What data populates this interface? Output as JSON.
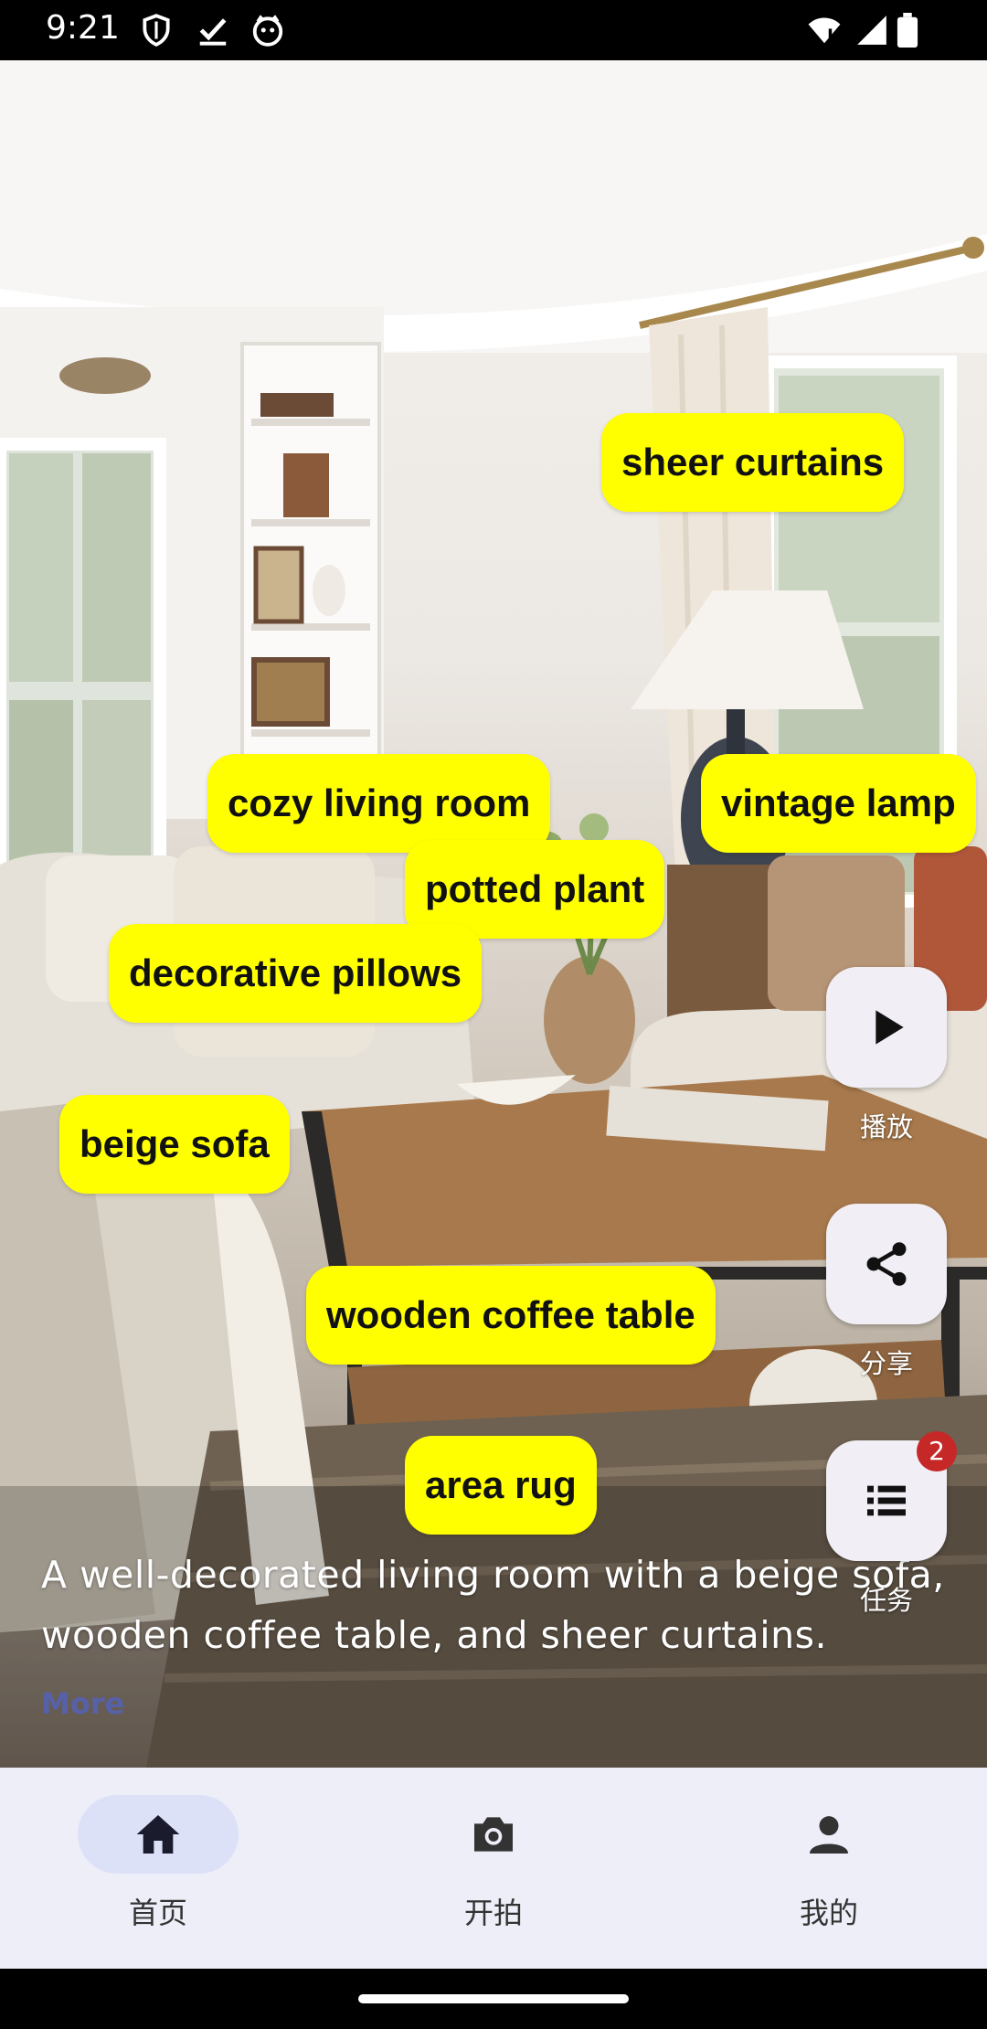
{
  "status_bar": {
    "time": "9:21",
    "icons": [
      "shield-icon",
      "check-download-icon",
      "cat-app-icon",
      "wifi-icon",
      "signal-icon",
      "battery-icon"
    ]
  },
  "scene": {
    "tags": [
      {
        "id": "sheer-curtains",
        "label": "sheer curtains"
      },
      {
        "id": "cozy-living-room",
        "label": "cozy living room"
      },
      {
        "id": "vintage-lamp",
        "label": "vintage lamp"
      },
      {
        "id": "potted-plant",
        "label": "potted plant"
      },
      {
        "id": "decorative-pillows",
        "label": "decorative pillows"
      },
      {
        "id": "beige-sofa",
        "label": "beige sofa"
      },
      {
        "id": "wooden-coffee-table",
        "label": "wooden coffee table"
      },
      {
        "id": "area-rug",
        "label": "area rug"
      }
    ],
    "caption": "A well-decorated living room with a beige sofa, wooden coffee table, and sheer curtains.",
    "more_label": "More"
  },
  "actions": {
    "play": {
      "icon": "play-icon",
      "label": "播放"
    },
    "share": {
      "icon": "share-icon",
      "label": "分享"
    },
    "tasks": {
      "icon": "list-icon",
      "label": "任务",
      "badge": "2"
    }
  },
  "bottom_nav": {
    "items": [
      {
        "icon": "home-icon",
        "label": "首页",
        "active": true
      },
      {
        "icon": "camera-icon",
        "label": "开拍",
        "active": false
      },
      {
        "icon": "person-icon",
        "label": "我的",
        "active": false
      }
    ]
  },
  "colors": {
    "tag_background": "#ffff00",
    "more_link": "#5661a8",
    "badge": "#c62828",
    "nav_background": "#edeef8",
    "nav_active_pill": "#dde1f8"
  }
}
